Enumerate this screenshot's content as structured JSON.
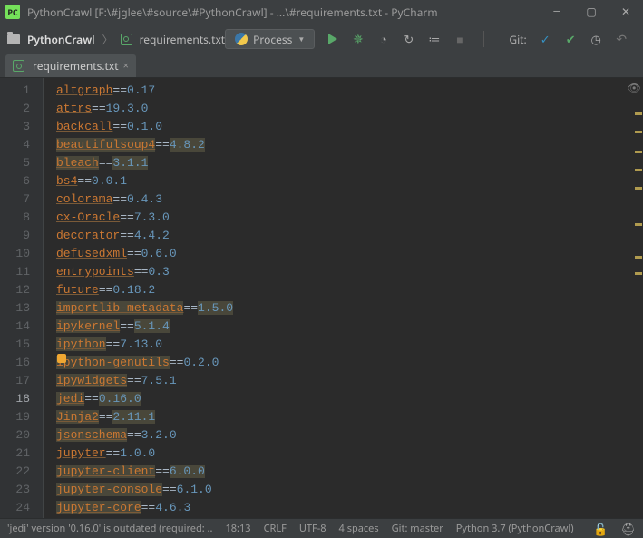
{
  "window": {
    "title": "PythonCrawl [F:\\#jglee\\#source\\#PythonCrawl] - ...\\#requirements.txt - PyCharm"
  },
  "breadcrumb": {
    "project": "PythonCrawl",
    "file": "requirements.txt"
  },
  "runconfig": {
    "label": "Process"
  },
  "toolbar": {
    "git_label": "Git:"
  },
  "tab": {
    "file": "requirements.txt",
    "close": "×"
  },
  "editor": {
    "cursor_line": 18,
    "lines": [
      {
        "n": 1,
        "pkg": "altgraph",
        "eq": "==",
        "ver": "0.17",
        "hl_pkg": false,
        "hl_ver": false
      },
      {
        "n": 2,
        "pkg": "attrs",
        "eq": "==",
        "ver": "19.3.0",
        "hl_pkg": false,
        "hl_ver": false
      },
      {
        "n": 3,
        "pkg": "backcall",
        "eq": "==",
        "ver": "0.1.0",
        "hl_pkg": false,
        "hl_ver": false
      },
      {
        "n": 4,
        "pkg": "beautifulsoup4",
        "eq": "==",
        "ver": "4.8.2",
        "hl_pkg": true,
        "hl_ver": true
      },
      {
        "n": 5,
        "pkg": "bleach",
        "eq": "==",
        "ver": "3.1.1",
        "hl_pkg": true,
        "hl_ver": true
      },
      {
        "n": 6,
        "pkg": "bs4",
        "eq": "==",
        "ver": "0.0.1",
        "hl_pkg": false,
        "hl_ver": false
      },
      {
        "n": 7,
        "pkg": "colorama",
        "eq": "==",
        "ver": "0.4.3",
        "hl_pkg": false,
        "hl_ver": false
      },
      {
        "n": 8,
        "pkg": "cx-Oracle",
        "eq": "==",
        "ver": "7.3.0",
        "hl_pkg": false,
        "hl_ver": false
      },
      {
        "n": 9,
        "pkg": "decorator",
        "eq": "==",
        "ver": "4.4.2",
        "hl_pkg": false,
        "hl_ver": false
      },
      {
        "n": 10,
        "pkg": "defusedxml",
        "eq": "==",
        "ver": "0.6.0",
        "hl_pkg": false,
        "hl_ver": false
      },
      {
        "n": 11,
        "pkg": "entrypoints",
        "eq": "==",
        "ver": "0.3",
        "hl_pkg": false,
        "hl_ver": false
      },
      {
        "n": 12,
        "pkg": "future",
        "eq": "==",
        "ver": "0.18.2",
        "hl_pkg": false,
        "hl_ver": false
      },
      {
        "n": 13,
        "pkg": "importlib-metadata",
        "eq": "==",
        "ver": "1.5.0",
        "hl_pkg": true,
        "hl_ver": true
      },
      {
        "n": 14,
        "pkg": "ipykernel",
        "eq": "==",
        "ver": "5.1.4",
        "hl_pkg": true,
        "hl_ver": true
      },
      {
        "n": 15,
        "pkg": "ipython",
        "eq": "==",
        "ver": "7.13.0",
        "hl_pkg": true,
        "hl_ver": false
      },
      {
        "n": 16,
        "pkg": "ipython-genutils",
        "eq": "==",
        "ver": "0.2.0",
        "hl_pkg": true,
        "hl_ver": false
      },
      {
        "n": 17,
        "pkg": "ipywidgets",
        "eq": "==",
        "ver": "7.5.1",
        "hl_pkg": true,
        "hl_ver": false
      },
      {
        "n": 18,
        "pkg": "jedi",
        "eq": "==",
        "ver": "0.16.0",
        "hl_pkg": true,
        "hl_ver": true,
        "caret": true
      },
      {
        "n": 19,
        "pkg": "Jinja2",
        "eq": "==",
        "ver": "2.11.1",
        "hl_pkg": true,
        "hl_ver": true
      },
      {
        "n": 20,
        "pkg": "jsonschema",
        "eq": "==",
        "ver": "3.2.0",
        "hl_pkg": true,
        "hl_ver": false
      },
      {
        "n": 21,
        "pkg": "jupyter",
        "eq": "==",
        "ver": "1.0.0",
        "hl_pkg": false,
        "hl_ver": false
      },
      {
        "n": 22,
        "pkg": "jupyter-client",
        "eq": "==",
        "ver": "6.0.0",
        "hl_pkg": true,
        "hl_ver": true
      },
      {
        "n": 23,
        "pkg": "jupyter-console",
        "eq": "==",
        "ver": "6.1.0",
        "hl_pkg": true,
        "hl_ver": false
      },
      {
        "n": 24,
        "pkg": "jupyter-core",
        "eq": "==",
        "ver": "4.6.3",
        "hl_pkg": true,
        "hl_ver": false
      }
    ],
    "stripe_marks": [
      38,
      58,
      80,
      100,
      120,
      160,
      196,
      214
    ]
  },
  "status": {
    "message": "'jedi' version '0.16.0' is outdated (required: ..",
    "pos": "18:13",
    "eol": "CRLF",
    "encoding": "UTF-8",
    "indent": "4 spaces",
    "git": "Git: master",
    "interpreter": "Python 3.7 (PythonCrawl)"
  }
}
